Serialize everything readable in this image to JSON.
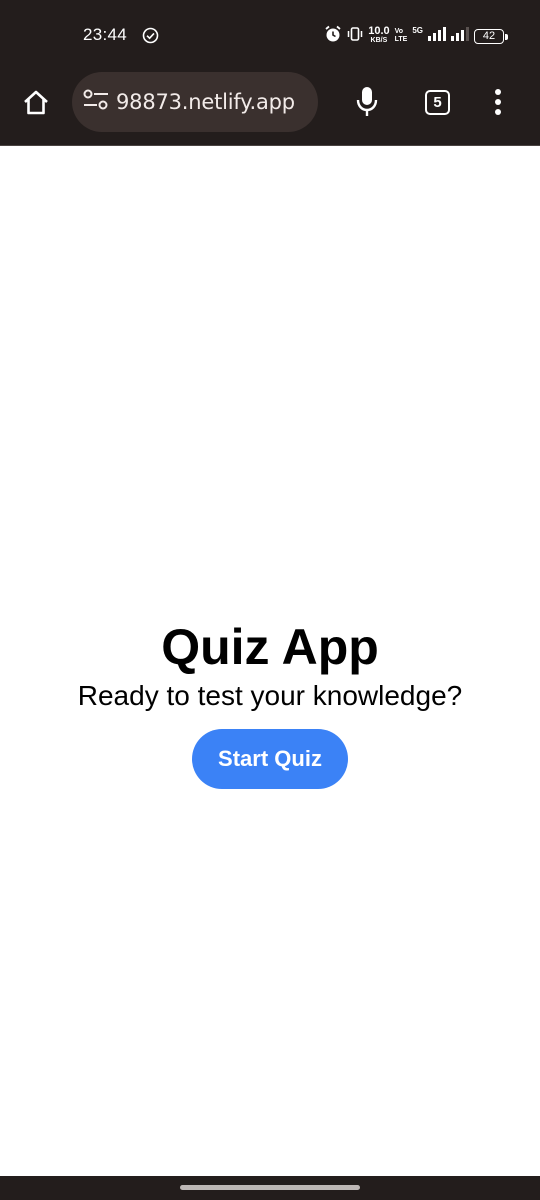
{
  "status_bar": {
    "time": "23:44",
    "net_speed_value": "10.0",
    "net_speed_unit": "KB/S",
    "volte_top": "Vo",
    "volte_bottom": "LTE",
    "network_type": "5G",
    "battery": "42",
    "icons": [
      "check-circle-icon",
      "alarm-icon",
      "vibrate-icon",
      "signal-icon",
      "signal-icon-2"
    ]
  },
  "browser": {
    "url": "98873.netlify.app",
    "tab_count": "5",
    "icons": [
      "home-icon",
      "site-settings-icon",
      "mic-icon",
      "more-vert-icon"
    ]
  },
  "page": {
    "title": "Quiz App",
    "subtitle": "Ready to test your knowledge?",
    "start_button": "Start Quiz"
  },
  "colors": {
    "chrome_bg": "#231d1c",
    "url_pill_bg": "#3a302e",
    "button_bg": "#3b82f6",
    "page_bg": "#ffffff"
  }
}
